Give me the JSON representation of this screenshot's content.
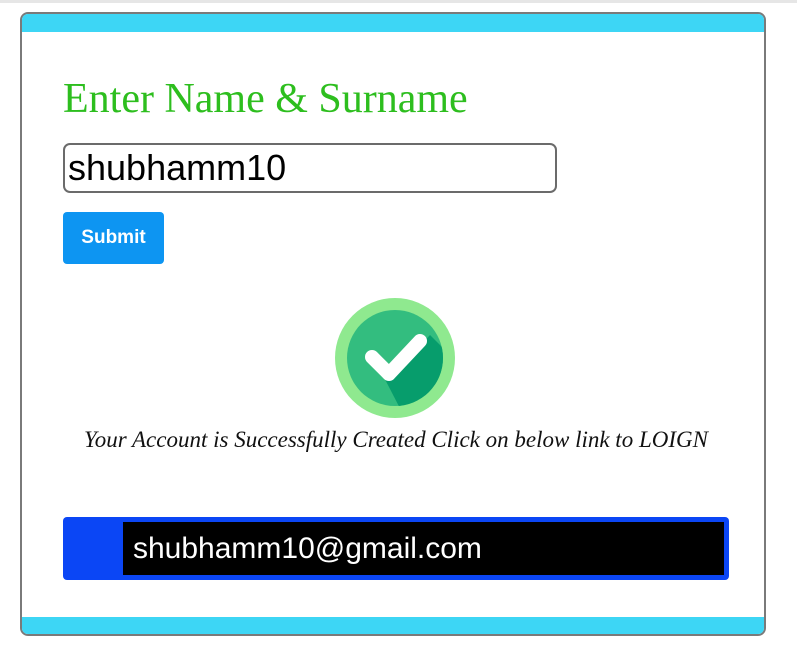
{
  "form": {
    "heading": "Enter Name & Surname",
    "name_value": "shubhamm10",
    "submit_label": "Submit"
  },
  "success": {
    "icon": "check-circle-icon",
    "message": "Your Account is Successfully Created Click on below link to LOIGN"
  },
  "account": {
    "email": "shubhamm10@gmail.com"
  },
  "colors": {
    "accent_bar": "#3dd6f5",
    "heading": "#2dbe1e",
    "submit_button": "#0d95f2",
    "email_box": "#0b46f5",
    "email_inner": "#000000",
    "icon_ring": "#8fe98f",
    "icon_fill": "#33bd7f"
  }
}
